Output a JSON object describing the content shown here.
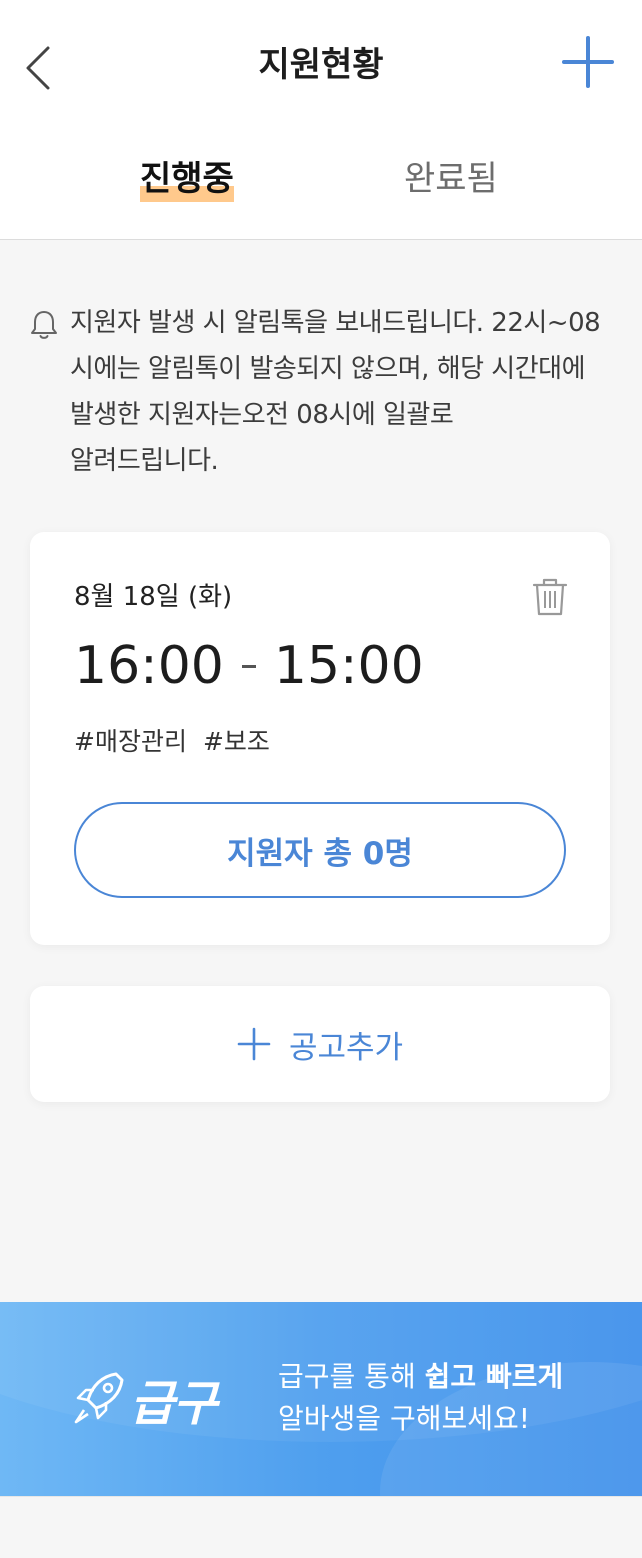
{
  "header": {
    "title": "지원현황",
    "back_icon": "chevron-left-icon",
    "add_icon": "plus-icon"
  },
  "tabs": [
    {
      "label": "진행중",
      "active": true
    },
    {
      "label": "완료됨",
      "active": false
    }
  ],
  "notice": {
    "icon": "bell-icon",
    "lines": [
      "지원자 발생 시 알림톡을 보내드립니다. 22시~08",
      "시에는 알림톡이 발송되지 않으며, 해당 시간대에",
      "발생한 지원자는오전 08시에 일괄로",
      "알려드립니다."
    ]
  },
  "job": {
    "date": "8월 18일 (화)",
    "start_time": "16:00",
    "end_time": "15:00",
    "tags": [
      "#매장관리",
      "#보조"
    ],
    "applicants_label": "지원자 총 0명",
    "delete_icon": "trash-icon"
  },
  "add_post": {
    "label": "공고추가",
    "icon": "plus-icon"
  },
  "banner": {
    "brand": "급구",
    "line1_prefix": "급구를 통해 ",
    "line1_bold": "쉽고 빠르게",
    "line2": "알바생을 구해보세요!",
    "icon": "rocket-icon"
  },
  "colors": {
    "accent": "#4a86d6",
    "tab_highlight": "#ffc98c",
    "banner_start": "#6fb8f5",
    "banner_end": "#3f90eb"
  }
}
